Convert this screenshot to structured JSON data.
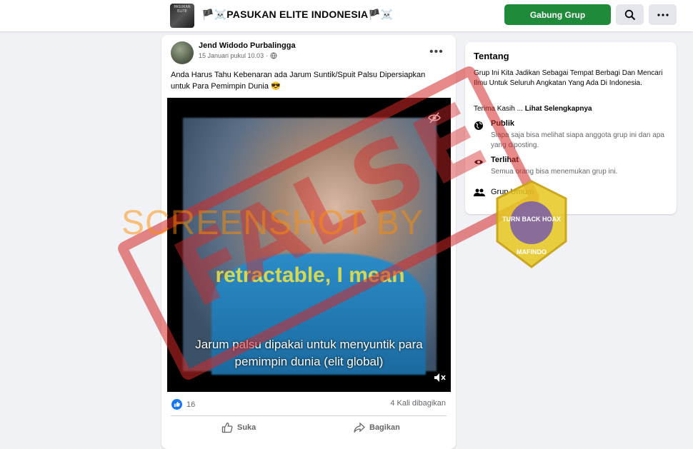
{
  "topbar": {
    "group_thumb_text": "PASUKAN ELITE",
    "group_name": "🏴☠️PASUKAN ELITE INDONESIA🏴☠️",
    "join_label": "Gabung Grup",
    "search_icon": "search-icon",
    "more_icon": "more-horizontal-icon",
    "accent_color": "#1f8a3a"
  },
  "post": {
    "author": "Jend Widodo Purbalingga",
    "date": "15 Januari pukul 10.03",
    "separator": "·",
    "text": "Anda Harus Tahu Kebenaran ada Jarum Suntik/Spuit Palsu Dipersiapkan untuk Para Pemimpin Dunia  😎",
    "video": {
      "caption_english": "retractable, I mean",
      "subtitle_line1": "Jarum palsu dipakai untuk menyuntik para",
      "subtitle_line2": "pemimpin dunia (elit global)"
    },
    "reactions_count": "16",
    "shares": "4 Kali dibagikan",
    "like_label": "Suka",
    "share_label": "Bagikan"
  },
  "about": {
    "title": "Tentang",
    "description": "Grup Ini Kita Jadikan Sebagai Tempat Berbagi Dan Mencari Ilmu Untuk Seluruh Angkatan Yang Ada Di Indonesia.",
    "thanks_prefix": "Terima Kasih ... ",
    "thanks_link": "Lihat Selengkapnya",
    "public_title": "Publik",
    "public_desc": "Siapa saja bisa melihat siapa anggota grup ini dan apa yang diposting.",
    "visible_title": "Terlihat",
    "visible_desc": "Semua orang bisa menemukan grup ini.",
    "general_label": "Grup Umum"
  },
  "overlay": {
    "stamp": "FALSE",
    "watermark": "SCREENSHOT BY",
    "badge_top": "TURN BACK HOAX",
    "badge_ring": "MASYARAKAT ANTIFITNAH INDONESIA",
    "badge_bottom": "MAFINDO",
    "stamp_color": "#d62828"
  }
}
